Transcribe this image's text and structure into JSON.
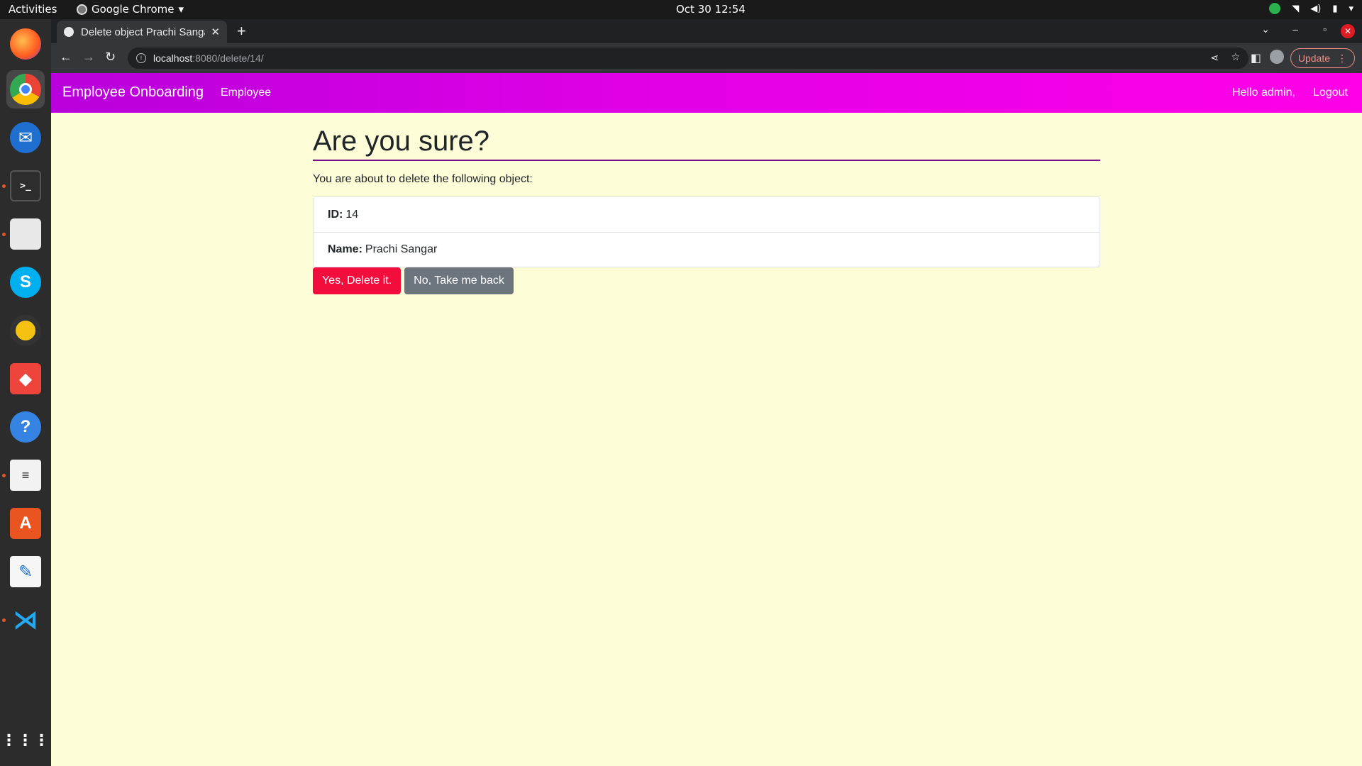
{
  "system": {
    "activities": "Activities",
    "app_name": "Google Chrome",
    "clock": "Oct 30  12:54"
  },
  "browser": {
    "tab_title": "Delete object Prachi Sangar",
    "url_host": "localhost",
    "url_path": ":8080/delete/14/",
    "update_label": "Update"
  },
  "navbar": {
    "brand": "Employee Onboarding",
    "employee_link": "Employee",
    "greeting": "Hello admin,",
    "logout": "Logout",
    "gradient": [
      "#b800dc",
      "#ff00e8"
    ]
  },
  "confirm": {
    "heading": "Are you sure?",
    "intro": "You are about to delete the following object:",
    "fields": [
      {
        "label": "ID:",
        "value": "14"
      },
      {
        "label": "Name:",
        "value": "Prachi Sangar"
      }
    ],
    "yes_label": "Yes, Delete it.",
    "no_label": "No, Take me back",
    "yes_color": "#f20d3d",
    "no_color": "#6c757d"
  },
  "dock": {
    "icons": [
      "firefox-icon",
      "chrome-icon",
      "thunderbird-icon",
      "terminal-icon",
      "files-icon",
      "skype-icon",
      "rhythmbox-icon",
      "anydesk-icon",
      "help-icon",
      "document-viewer-icon",
      "software-center-icon",
      "text-editor-icon",
      "vscode-icon",
      "show-apps-icon"
    ]
  }
}
